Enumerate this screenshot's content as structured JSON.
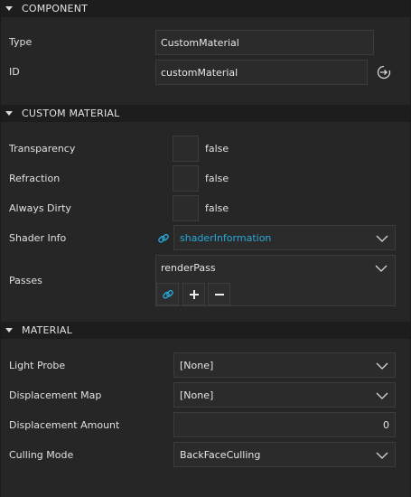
{
  "sections": {
    "component": {
      "title": "COMPONENT"
    },
    "custom_material": {
      "title": "CUSTOM MATERIAL"
    },
    "material": {
      "title": "MATERIAL"
    }
  },
  "component": {
    "type_label": "Type",
    "type_value": "CustomMaterial",
    "id_label": "ID",
    "id_value": "customMaterial"
  },
  "custom_material": {
    "transparency_label": "Transparency",
    "transparency_value": "false",
    "refraction_label": "Refraction",
    "refraction_value": "false",
    "always_dirty_label": "Always Dirty",
    "always_dirty_value": "false",
    "shader_info_label": "Shader Info",
    "shader_info_value": "shaderInformation",
    "passes_label": "Passes",
    "passes_value": "renderPass"
  },
  "material": {
    "light_probe_label": "Light Probe",
    "light_probe_value": "[None]",
    "displacement_map_label": "Displacement Map",
    "displacement_map_value": "[None]",
    "displacement_amount_label": "Displacement Amount",
    "displacement_amount_value": "0",
    "culling_mode_label": "Culling Mode",
    "culling_mode_value": "BackFaceCulling"
  },
  "colors": {
    "link": "#29a8d8",
    "background": "#262626",
    "header": "#1d1d1d"
  }
}
